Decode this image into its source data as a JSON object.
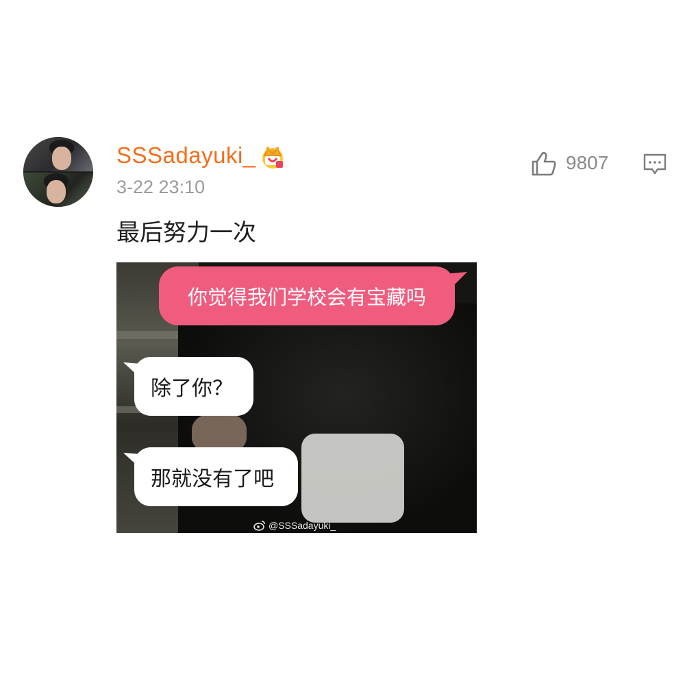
{
  "post": {
    "username": "SSSadayuki_",
    "timestamp": "3-22 23:10",
    "text": "最后努力一次",
    "like_count": "9807",
    "badge_icon": "crown-badge-icon",
    "like_icon": "thumbs-up-icon",
    "comment_icon": "comment-icon"
  },
  "meme": {
    "bubble_1": "你觉得我们学校会有宝藏吗",
    "bubble_2": "除了你？",
    "bubble_3": "那就没有了吧",
    "watermark": "@SSSadayuki_"
  },
  "colors": {
    "username": "#f36d1b",
    "pink_bubble": "#f05c7e",
    "meta_gray": "#9b9b9b"
  }
}
